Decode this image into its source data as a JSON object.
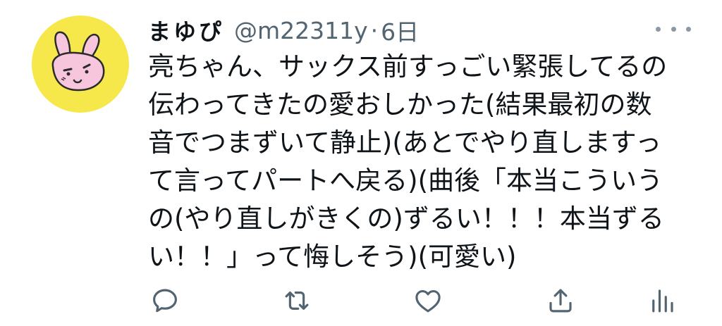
{
  "tweet": {
    "author_name": "まゆぴ",
    "handle": "@m22311y",
    "separator": "·",
    "time": "6日",
    "text_lines": [
      "亮ちゃん、サックス前すっごい緊張してるの",
      "伝わってきたの愛おしかった(結果最初の数",
      "音でつまずいて静止)(あとでやり直しますっ",
      "て言ってパートへ戻る)(曲後「本当こういう",
      "の(やり直しがきくの)ずるい！！！本当ずる",
      "い！！」って悔しそう)(可愛い)"
    ]
  },
  "icons": {
    "more": "more-horizontal-icon",
    "reply": "reply-icon",
    "retweet": "retweet-icon",
    "like": "like-icon",
    "share": "share-icon",
    "analytics": "analytics-icon"
  },
  "colors": {
    "text": "#0f1419",
    "secondary": "#536471",
    "icon": "#536471",
    "avatar_bg": "#f6e84b",
    "avatar_rabbit": "#f7c6dc"
  }
}
